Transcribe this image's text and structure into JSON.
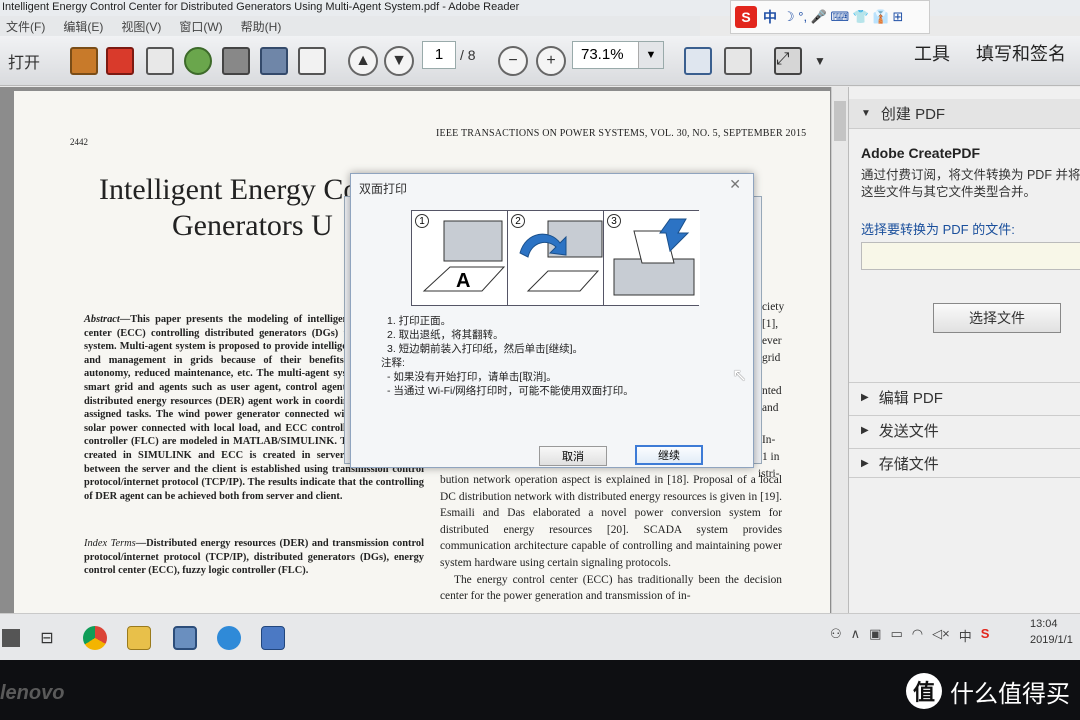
{
  "window": {
    "title": "Intelligent Energy Control Center for Distributed Generators Using Multi-Agent System.pdf - Adobe Reader"
  },
  "ime_bar": {
    "logo": "S",
    "mode": "中",
    "symbols": "☽ °, 🎤 ⌨ 👕 👔 ⊞"
  },
  "menu": {
    "items": [
      "文件(F)",
      "编辑(E)",
      "视图(V)",
      "窗口(W)",
      "帮助(H)"
    ]
  },
  "toolbar": {
    "open_label": "打开",
    "page_current": "1",
    "page_total": "/ 8",
    "zoom": "73.1%",
    "tools_label": "工具",
    "fill_sign_label": "填写和签名"
  },
  "document": {
    "page_number": "2442",
    "journal": "IEEE TRANSACTIONS ON POWER SYSTEMS, VOL. 30, NO. 5, SEPTEMBER 2015",
    "title_line1": "Intelligent Energy Control Center for Distributed",
    "title_line2": "Generators U",
    "author_fragment": "I",
    "abstract_label": "Abstract",
    "abstract_text": "—This paper presents the modeling of intelligent energy control center (ECC) controlling distributed generators (DGs) using multi-agent system. Multi-agent system is proposed to provide intelligent energy control and management in grids because of their benefits of extensibility, autonomy, reduced maintenance, etc. The multi-agent system constitutes a smart grid and agents such as user agent, control agent, database agent, distributed energy resources (DER) agent work in coordination to perform assigned tasks. The wind power generator connected with local load, the solar power connected with local load, and ECC controlled by fuzzy logic controller (FLC) are modeled in MATLAB/SIMULINK. The DER model is created in SIMULINK and ECC is created in server. Communication between the server and the client is established using transmission control protocol/internet protocol (TCP/IP). The results indicate that the controlling of DER agent can be achieved both from server and client.",
    "index_label": "Index Terms",
    "index_text": "—Distributed energy resources (DER) and transmission control protocol/internet protocol (TCP/IP), distributed generators (DGs), energy control center (ECC), fuzzy logic controller (FLC).",
    "right_fragments": [
      "ciety",
      "[1],",
      "ever",
      "grid",
      "nted",
      "and",
      "In-",
      "1 in",
      "istri-"
    ],
    "right_text": "bution network operation aspect is explained in [18]. Proposal of a local DC distribution network with distributed energy resources is given in [19]. Esmaili and Das elaborated a novel power conversion system for distributed energy resources [20]. SCADA system provides communication architecture capable of controlling and maintaining power system hardware using certain signaling protocols.",
    "right_text_2": "The energy control center (ECC) has traditionally been the decision center for the power generation and transmission of in-"
  },
  "right_pane": {
    "create_header": "创建 PDF",
    "product_title": "Adobe CreatePDF",
    "description": "通过付费订阅，将文件转换为 PDF 并将这些文件与其它文件类型合并。",
    "select_label": "选择要转换为 PDF 的文件:",
    "select_button": "选择文件",
    "edit_header": "编辑 PDF",
    "send_header": "发送文件",
    "store_header": "存储文件"
  },
  "dialog": {
    "title": "双面打印",
    "step1": "1. 打印正面。",
    "step2": "2. 取出退纸，将其翻转。",
    "step3": "3. 短边朝前装入打印纸，然后单击[继续]。",
    "note_label": "注释:",
    "note1": "- 如果没有开始打印，请单击[取消]。",
    "note2": "- 当通过 Wi-Fi/网络打印时，可能不能使用双面打印。",
    "panel_numbers": [
      "1",
      "2",
      "3"
    ],
    "cancel_label": "取消",
    "continue_label": "继续"
  },
  "taskbar": {
    "tray_ime": "中",
    "time": "13:04",
    "date": "2019/1/1"
  },
  "bezel": {
    "brand": "lenovo"
  },
  "watermark": {
    "badge": "值",
    "text": "什么值得买"
  }
}
